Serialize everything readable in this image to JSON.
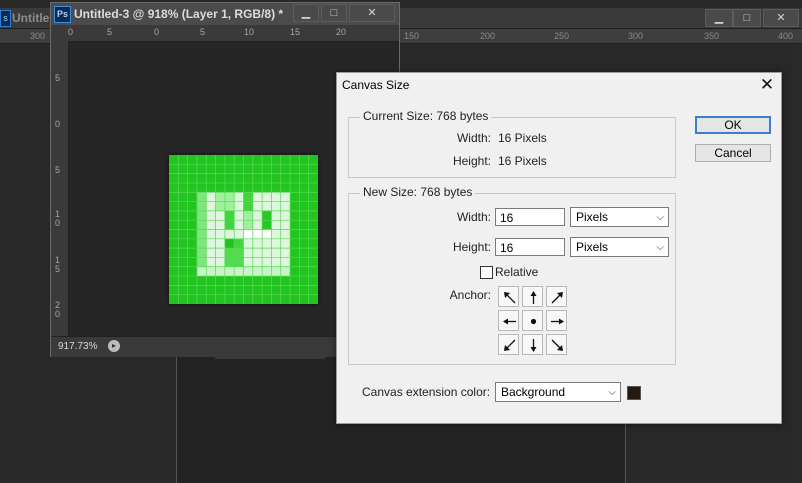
{
  "background_window": {
    "title": "Untitle",
    "ps_icon_text": "s",
    "ruler_labels": [
      "300",
      "150",
      "200",
      "250",
      "300",
      "350",
      "400"
    ]
  },
  "document_window": {
    "ps_icon_text": "Ps",
    "title": "Untitled-3 @ 918% (Layer 1, RGB/8) *",
    "ruler_top_labels": [
      "0",
      "5",
      "0",
      "5",
      "10",
      "15",
      "20"
    ],
    "ruler_left_labels": [
      "5",
      "0",
      "5",
      "1\n0",
      "1\n5",
      "2\n0"
    ],
    "zoom": "917.73%",
    "canvas_color": "#22c41f"
  },
  "dialog": {
    "title": "Canvas Size",
    "close_glyph": "✕",
    "current_size": {
      "legend": "Current Size: 768 bytes",
      "width_label": "Width:",
      "width_value": "16 Pixels",
      "height_label": "Height:",
      "height_value": "16 Pixels"
    },
    "new_size": {
      "legend": "New Size: 768 bytes",
      "width_label": "Width:",
      "width_value": "16",
      "width_unit": "Pixels",
      "height_label": "Height:",
      "height_value": "16",
      "height_unit": "Pixels",
      "relative_label": "Relative",
      "relative_checked": false,
      "anchor_label": "Anchor:"
    },
    "extension": {
      "label": "Canvas extension color:",
      "value": "Background",
      "swatch_color": "#231a12"
    },
    "ok_label": "OK",
    "cancel_label": "Cancel"
  },
  "icons": {
    "window_controls": [
      "minimize-icon",
      "maximize-icon",
      "close-icon"
    ],
    "anchor": [
      "arrow-nw-icon",
      "arrow-n-icon",
      "arrow-ne-icon",
      "arrow-w-icon",
      "anchor-center-icon",
      "arrow-e-icon",
      "arrow-sw-icon",
      "arrow-s-icon",
      "arrow-se-icon"
    ]
  }
}
